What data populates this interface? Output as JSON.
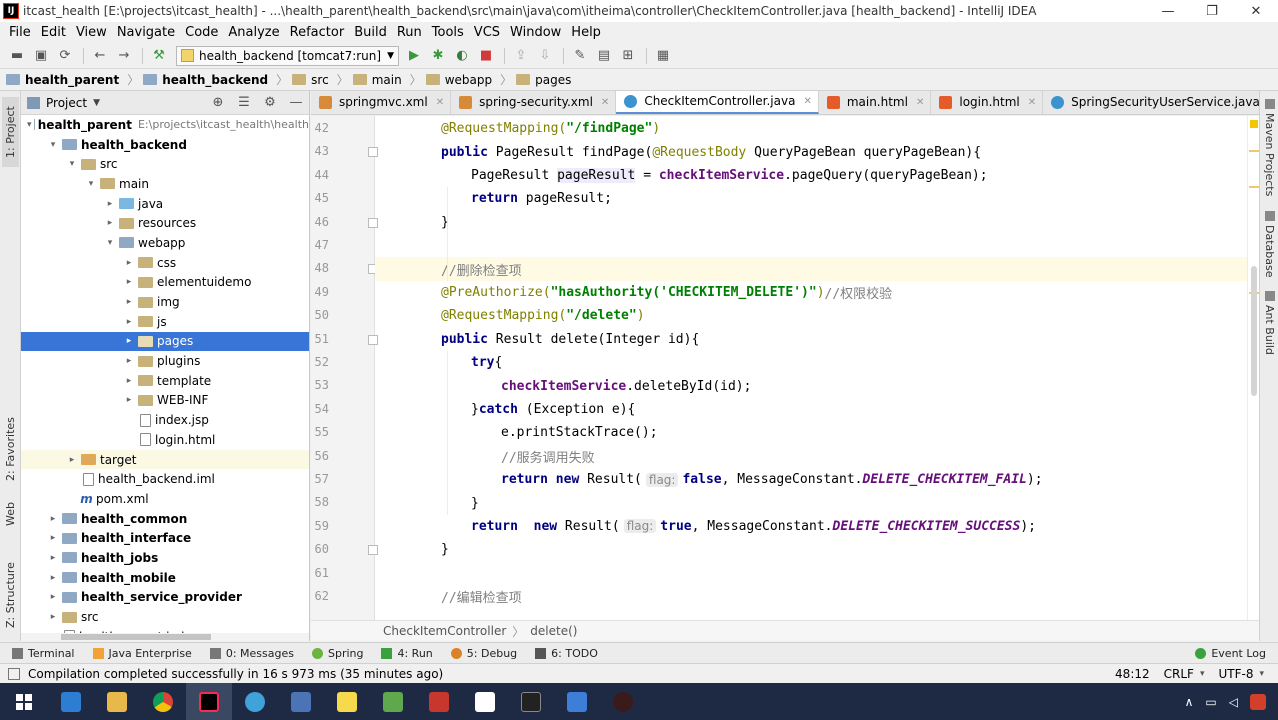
{
  "window": {
    "title": "itcast_health [E:\\projects\\itcast_health] - ...\\health_parent\\health_backend\\src\\main\\java\\com\\itheima\\controller\\CheckItemController.java [health_backend] - IntelliJ IDEA",
    "app_icon": "IJ",
    "minimize": "—",
    "maximize": "❐",
    "close": "✕"
  },
  "menu": [
    "File",
    "Edit",
    "View",
    "Navigate",
    "Code",
    "Analyze",
    "Refactor",
    "Build",
    "Run",
    "Tools",
    "VCS",
    "Window",
    "Help"
  ],
  "toolbar": {
    "run_config": "health_backend [tomcat7:run]"
  },
  "breadcrumb": [
    "health_parent",
    "health_backend",
    "src",
    "main",
    "webapp",
    "pages"
  ],
  "left_stripe": {
    "project": "1: Project",
    "favorites": "2: Favorites",
    "web": "Web",
    "structure": "Z: Structure"
  },
  "project_panel": {
    "title": "Project",
    "tree": [
      {
        "label": "health_parent",
        "path": "E:\\projects\\itcast_health\\health",
        "bold": true,
        "icon": "module",
        "arrow": "▾",
        "indent": 0
      },
      {
        "label": "health_backend",
        "path": "",
        "bold": true,
        "icon": "module",
        "arrow": "▾",
        "indent": 1
      },
      {
        "label": "src",
        "path": "",
        "bold": false,
        "icon": "folder",
        "arrow": "▾",
        "indent": 2
      },
      {
        "label": "main",
        "path": "",
        "bold": false,
        "icon": "folder",
        "arrow": "▾",
        "indent": 3
      },
      {
        "label": "java",
        "path": "",
        "bold": false,
        "icon": "src",
        "arrow": "▸",
        "indent": 4
      },
      {
        "label": "resources",
        "path": "",
        "bold": false,
        "icon": "res",
        "arrow": "▸",
        "indent": 4
      },
      {
        "label": "webapp",
        "path": "",
        "bold": false,
        "icon": "module",
        "arrow": "▾",
        "indent": 4
      },
      {
        "label": "css",
        "path": "",
        "bold": false,
        "icon": "folder",
        "arrow": "▸",
        "indent": 5
      },
      {
        "label": "elementuidemo",
        "path": "",
        "bold": false,
        "icon": "folder",
        "arrow": "▸",
        "indent": 5
      },
      {
        "label": "img",
        "path": "",
        "bold": false,
        "icon": "folder",
        "arrow": "▸",
        "indent": 5
      },
      {
        "label": "js",
        "path": "",
        "bold": false,
        "icon": "folder",
        "arrow": "▸",
        "indent": 5
      },
      {
        "label": "pages",
        "path": "",
        "bold": false,
        "icon": "folder",
        "arrow": "▸",
        "indent": 5,
        "selected": true
      },
      {
        "label": "plugins",
        "path": "",
        "bold": false,
        "icon": "folder",
        "arrow": "▸",
        "indent": 5
      },
      {
        "label": "template",
        "path": "",
        "bold": false,
        "icon": "folder",
        "arrow": "▸",
        "indent": 5
      },
      {
        "label": "WEB-INF",
        "path": "",
        "bold": false,
        "icon": "folder",
        "arrow": "▸",
        "indent": 5
      },
      {
        "label": "index.jsp",
        "path": "",
        "bold": false,
        "icon": "file",
        "arrow": "",
        "indent": 5
      },
      {
        "label": "login.html",
        "path": "",
        "bold": false,
        "icon": "file",
        "arrow": "",
        "indent": 5
      },
      {
        "label": "target",
        "path": "",
        "bold": false,
        "icon": "target",
        "arrow": "▸",
        "indent": 2,
        "highlight": true
      },
      {
        "label": "health_backend.iml",
        "path": "",
        "bold": false,
        "icon": "file",
        "arrow": "",
        "indent": 2
      },
      {
        "label": "pom.xml",
        "path": "",
        "bold": false,
        "icon": "pom",
        "arrow": "",
        "indent": 2
      },
      {
        "label": "health_common",
        "path": "",
        "bold": true,
        "icon": "module",
        "arrow": "▸",
        "indent": 1
      },
      {
        "label": "health_interface",
        "path": "",
        "bold": true,
        "icon": "module",
        "arrow": "▸",
        "indent": 1
      },
      {
        "label": "health_jobs",
        "path": "",
        "bold": true,
        "icon": "module",
        "arrow": "▸",
        "indent": 1
      },
      {
        "label": "health_mobile",
        "path": "",
        "bold": true,
        "icon": "module",
        "arrow": "▸",
        "indent": 1
      },
      {
        "label": "health_service_provider",
        "path": "",
        "bold": true,
        "icon": "module",
        "arrow": "▸",
        "indent": 1
      },
      {
        "label": "src",
        "path": "",
        "bold": false,
        "icon": "folder",
        "arrow": "▸",
        "indent": 1
      },
      {
        "label": "health_parent.iml",
        "path": "",
        "bold": false,
        "icon": "file",
        "arrow": "",
        "indent": 1
      }
    ]
  },
  "tabs": [
    {
      "label": "springmvc.xml",
      "type": "xml",
      "active": false
    },
    {
      "label": "spring-security.xml",
      "type": "xml",
      "active": false
    },
    {
      "label": "CheckItemController.java",
      "type": "java",
      "active": true
    },
    {
      "label": "main.html",
      "type": "html",
      "active": false
    },
    {
      "label": "login.html",
      "type": "html",
      "active": false
    },
    {
      "label": "SpringSecurityUserService.java",
      "type": "java",
      "active": false
    }
  ],
  "editor": {
    "current_line": 48,
    "lines": [
      {
        "n": 42,
        "indent": 1,
        "tokens": [
          [
            "ann",
            "@RequestMapping("
          ],
          [
            "str",
            "\"/findPage\""
          ],
          [
            "ann",
            ")"
          ]
        ]
      },
      {
        "n": 43,
        "indent": 1,
        "tokens": [
          [
            "kw",
            "public "
          ],
          [
            "",
            "PageResult findPage("
          ],
          [
            "ann",
            "@RequestBody "
          ],
          [
            "",
            "QueryPageBean queryPageBean){"
          ]
        ]
      },
      {
        "n": 44,
        "indent": 2,
        "tokens": [
          [
            "",
            "PageResult "
          ],
          [
            "hl",
            "pageResult"
          ],
          [
            "",
            " = "
          ],
          [
            "fld",
            "checkItemService"
          ],
          [
            "",
            ".pageQuery(queryPageBean);"
          ]
        ]
      },
      {
        "n": 45,
        "indent": 2,
        "tokens": [
          [
            "kw",
            "return "
          ],
          [
            "",
            "pageResult;"
          ]
        ]
      },
      {
        "n": 46,
        "indent": 1,
        "tokens": [
          [
            "",
            "}"
          ]
        ]
      },
      {
        "n": 47,
        "indent": 0,
        "tokens": []
      },
      {
        "n": 48,
        "indent": 1,
        "tokens": [
          [
            "cmt",
            "//删除检查项"
          ]
        ]
      },
      {
        "n": 49,
        "indent": 1,
        "tokens": [
          [
            "ann",
            "@PreAuthorize("
          ],
          [
            "str",
            "\"hasAuthority('CHECKITEM_DELETE')\""
          ],
          [
            "ann",
            ")"
          ],
          [
            "cmt",
            "//权限校验"
          ]
        ]
      },
      {
        "n": 50,
        "indent": 1,
        "tokens": [
          [
            "ann",
            "@RequestMapping("
          ],
          [
            "str",
            "\"/delete\""
          ],
          [
            "ann",
            ")"
          ]
        ]
      },
      {
        "n": 51,
        "indent": 1,
        "tokens": [
          [
            "kw",
            "public "
          ],
          [
            "",
            "Result delete(Integer id){"
          ]
        ]
      },
      {
        "n": 52,
        "indent": 2,
        "tokens": [
          [
            "kw",
            "try"
          ],
          [
            "",
            "{"
          ]
        ]
      },
      {
        "n": 53,
        "indent": 3,
        "tokens": [
          [
            "fld",
            "checkItemService"
          ],
          [
            "",
            ".deleteById(id);"
          ]
        ]
      },
      {
        "n": 54,
        "indent": 2,
        "tokens": [
          [
            "",
            "}"
          ],
          [
            "kw",
            "catch "
          ],
          [
            "",
            "(Exception e){"
          ]
        ]
      },
      {
        "n": 55,
        "indent": 3,
        "tokens": [
          [
            "",
            "e.printStackTrace();"
          ]
        ]
      },
      {
        "n": 56,
        "indent": 3,
        "tokens": [
          [
            "cmt",
            "//服务调用失败"
          ]
        ]
      },
      {
        "n": 57,
        "indent": 3,
        "tokens": [
          [
            "kw",
            "return new "
          ],
          [
            "",
            "Result("
          ],
          [
            "hint",
            "flag:"
          ],
          [
            "kw",
            "false"
          ],
          [
            "",
            ", MessageConstant."
          ],
          [
            "cst",
            "DELETE_CHECKITEM_FAIL"
          ],
          [
            "",
            ");"
          ]
        ]
      },
      {
        "n": 58,
        "indent": 2,
        "tokens": [
          [
            "",
            "}"
          ]
        ]
      },
      {
        "n": 59,
        "indent": 2,
        "tokens": [
          [
            "kw",
            "return  new "
          ],
          [
            "",
            "Result("
          ],
          [
            "hint",
            "flag:"
          ],
          [
            "kw",
            "true"
          ],
          [
            "",
            ", MessageConstant."
          ],
          [
            "cst",
            "DELETE_CHECKITEM_SUCCESS"
          ],
          [
            "",
            ");"
          ]
        ]
      },
      {
        "n": 60,
        "indent": 1,
        "tokens": [
          [
            "",
            "}"
          ]
        ]
      },
      {
        "n": 61,
        "indent": 0,
        "tokens": []
      },
      {
        "n": 62,
        "indent": 1,
        "tokens": [
          [
            "cmt",
            "//编辑检查项"
          ]
        ]
      }
    ]
  },
  "right_stripe": [
    "Maven Projects",
    "Database",
    "Ant Build"
  ],
  "editor_breadcrumb": [
    "CheckItemController",
    "delete()"
  ],
  "bottom_tabs": [
    {
      "label": "Terminal",
      "icon": "terminal-icon",
      "cls": ""
    },
    {
      "label": "Java Enterprise",
      "icon": "java-enterprise-icon",
      "cls": "ee"
    },
    {
      "label": "0: Messages",
      "icon": "messages-icon",
      "cls": ""
    },
    {
      "label": "Spring",
      "icon": "spring-icon",
      "cls": "spring"
    },
    {
      "label": "4: Run",
      "icon": "run-icon",
      "cls": "run"
    },
    {
      "label": "5: Debug",
      "icon": "debug-icon",
      "cls": "debug"
    },
    {
      "label": "6: TODO",
      "icon": "todo-icon",
      "cls": "todo"
    }
  ],
  "event_log": "Event Log",
  "status": {
    "message": "Compilation completed successfully in 16 s 973 ms (35 minutes ago)",
    "position": "48:12",
    "line_sep": "CRLF",
    "encoding": "UTF-8"
  },
  "taskbar": {
    "apps": [
      "windows-start",
      "task-view",
      "file-explorer",
      "chrome",
      "intellij-idea",
      "browser",
      "powerpoint",
      "sticky",
      "rocket",
      "red-app",
      "typora",
      "terminal",
      "blue-app",
      "recorder"
    ],
    "active": "intellij-idea"
  }
}
